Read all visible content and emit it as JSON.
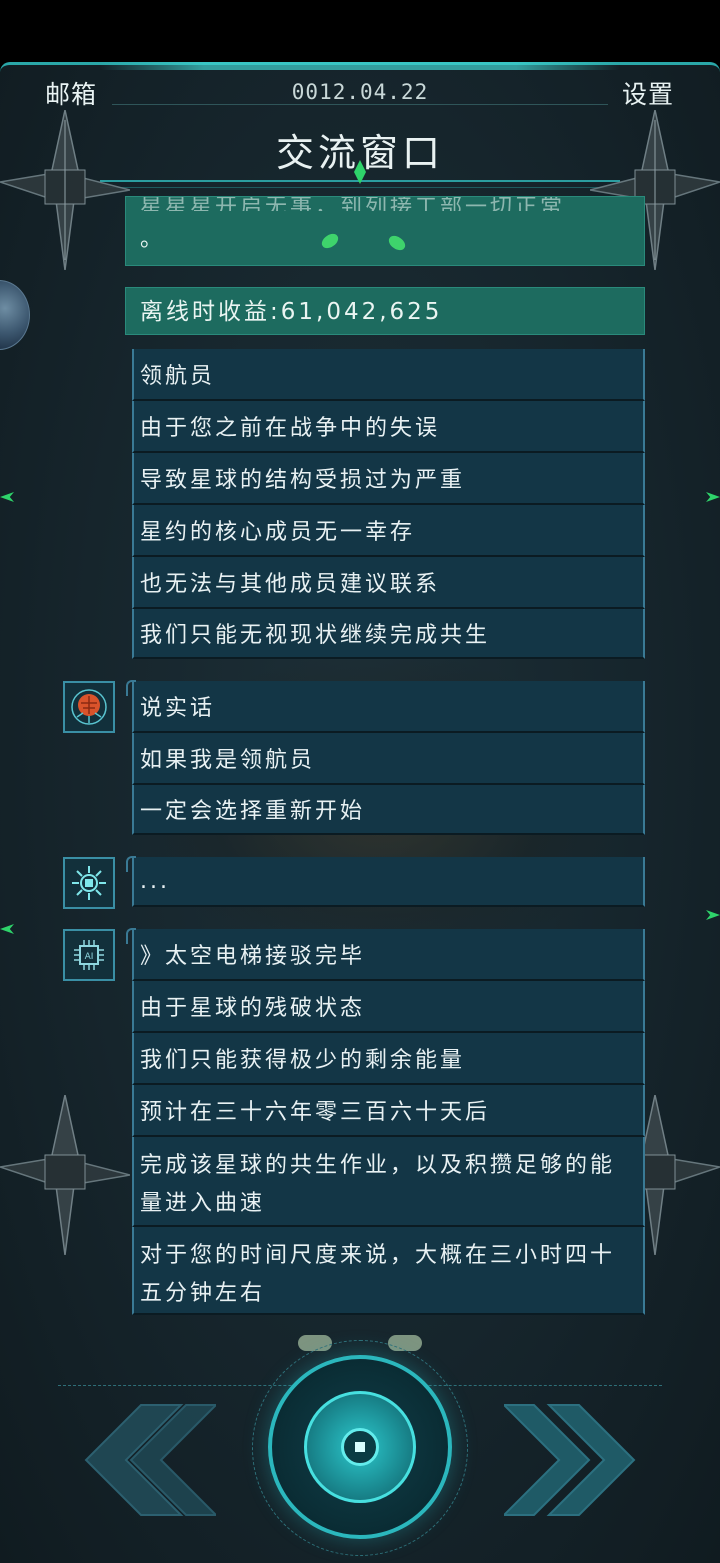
{
  "header": {
    "mailbox_label": "邮箱",
    "date": "0012.04.22",
    "settings_label": "设置",
    "title": "交流窗口"
  },
  "notices": {
    "partial_top_text": "星星星开启无事，到列接工部一切正常",
    "partial_bottom_text": "。",
    "offline_income": "离线时收益:61,042,625"
  },
  "groups": [
    {
      "speaker": "navigator",
      "lines": [
        "领航员",
        "由于您之前在战争中的失误",
        "导致星球的结构受损过为严重",
        "星约的核心成员无一幸存",
        "也无法与其他成员建议联系",
        "我们只能无视现状继续完成共生"
      ]
    },
    {
      "speaker": "brain-circuit",
      "lines": [
        "说实话",
        "如果我是领航员",
        "一定会选择重新开始"
      ]
    },
    {
      "speaker": "chip-sun",
      "lines": [
        "..."
      ]
    },
    {
      "speaker": "ai-chip",
      "lines": [
        "》太空电梯接驳完毕",
        "由于星球的残破状态",
        "我们只能获得极少的剩余能量",
        "预计在三十六年零三百六十天后",
        "完成该星球的共生作业，以及积攒足够的能量进入曲速",
        "对于您的时间尺度来说，大概在三小时四十五分钟左右"
      ]
    }
  ],
  "icons": {
    "prev": "double-chevron-left-icon",
    "next": "double-chevron-right-icon",
    "center": "core-button-icon",
    "accent": "#2bb7bd",
    "bubble": "#133646",
    "notice": "#1d6b5f"
  }
}
